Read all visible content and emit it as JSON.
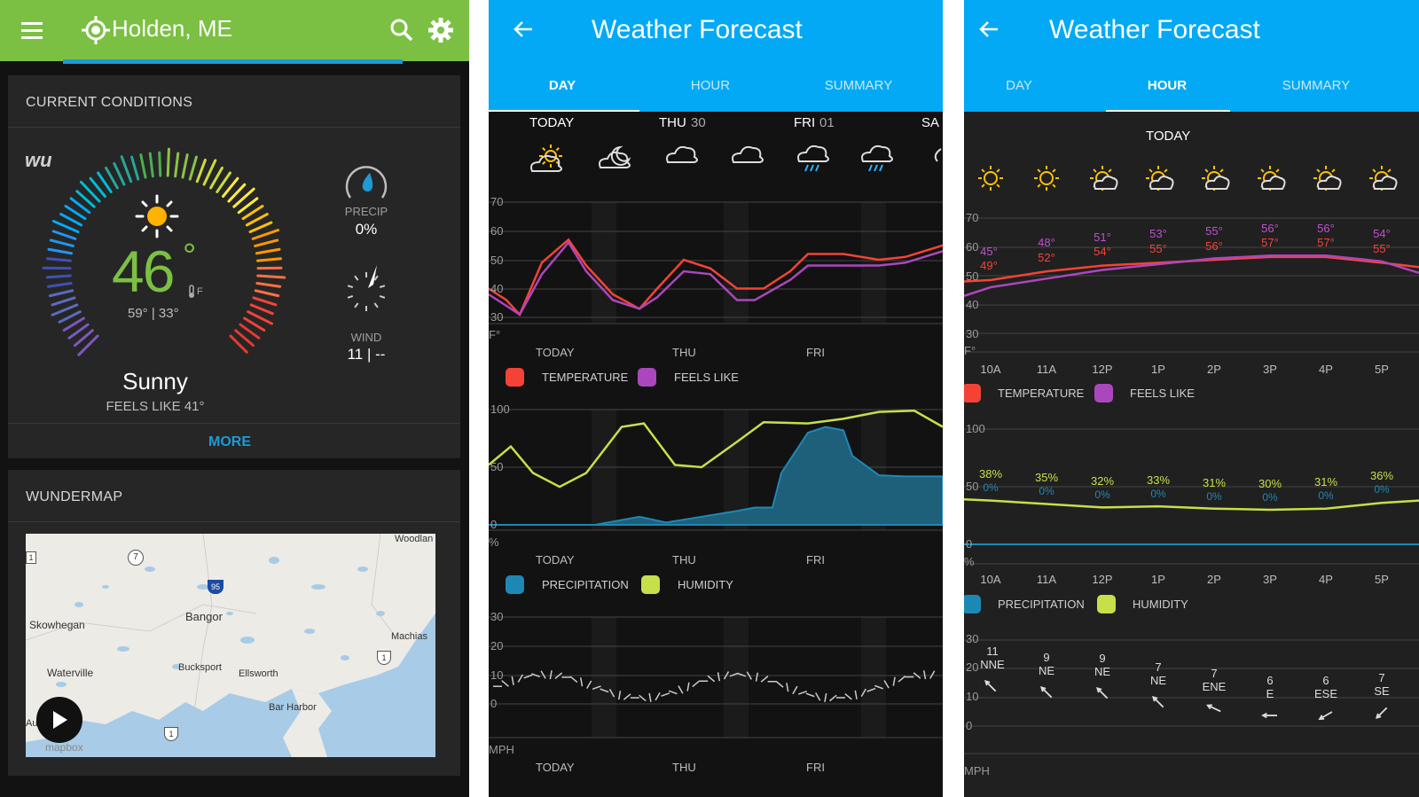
{
  "colors": {
    "green": "#7bc043",
    "blue": "#03a9f4",
    "temperature": "#f44336",
    "feels_like": "#ab47bc",
    "precipitation": "#1e88b5",
    "humidity": "#c6e04a",
    "link": "#1e9ad6"
  },
  "s1": {
    "location": "Holden, ME",
    "current": {
      "title": "CURRENT CONDITIONS",
      "temp": "46",
      "deg": "°",
      "unit": "F",
      "hilo": "59° | 33°",
      "condition": "Sunny",
      "feels_like": "FEELS LIKE 41°",
      "precip_label": "PRECIP",
      "precip_value": "0%",
      "wind_label": "WIND",
      "wind_value": "11 | --",
      "more": "MORE",
      "logo": "wu"
    },
    "map": {
      "title": "WUNDERMAP",
      "attribution": "mapbox",
      "places": {
        "woodland": "Woodlan",
        "skowhegan": "Skowhegan",
        "bangor": "Bangor",
        "machias": "Machias",
        "waterville": "Waterville",
        "bucksport": "Bucksport",
        "ellsworth": "Ellsworth",
        "bar_harbor": "Bar Harbor",
        "au": "Au"
      },
      "shields": {
        "s7": "7",
        "s95": "95",
        "s1a": "1",
        "s1b": "1",
        "s1c": "1"
      }
    }
  },
  "s2": {
    "title": "Weather Forecast",
    "tabs": [
      "DAY",
      "HOUR",
      "SUMMARY"
    ],
    "days": [
      "TODAY",
      "THU",
      "30",
      "FRI",
      "01",
      "SA"
    ],
    "x_labels": [
      "TODAY",
      "THU",
      "FRI"
    ],
    "temp_axis": [
      "70",
      "60",
      "50",
      "40",
      "30"
    ],
    "temp_unit": "F°",
    "legend1": [
      "TEMPERATURE",
      "FEELS LIKE"
    ],
    "hum_axis": [
      "100",
      "50",
      "0"
    ],
    "pct_unit": "%",
    "legend2": [
      "PRECIPITATION",
      "HUMIDITY"
    ],
    "wind_axis": [
      "30",
      "20",
      "10",
      "0"
    ],
    "wind_unit": "MPH"
  },
  "s3": {
    "title": "Weather Forecast",
    "tabs": [
      "DAY",
      "HOUR",
      "SUMMARY"
    ],
    "day": "TODAY",
    "hours": [
      "10A",
      "11A",
      "12P",
      "1P",
      "2P",
      "3P",
      "4P",
      "5P"
    ],
    "temp_axis": [
      "70",
      "60",
      "50",
      "40",
      "30"
    ],
    "temp_unit": "F°",
    "feels": [
      "45°",
      "48°",
      "51°",
      "53°",
      "55°",
      "56°",
      "56°",
      "54°"
    ],
    "temps": [
      "49°",
      "52°",
      "54°",
      "55°",
      "56°",
      "57°",
      "57°",
      "55°"
    ],
    "legend1": [
      "TEMPERATURE",
      "FEELS LIKE"
    ],
    "hum_axis": [
      "100",
      "50",
      "0"
    ],
    "pct_unit": "%",
    "humidity": [
      "38%",
      "35%",
      "32%",
      "33%",
      "31%",
      "30%",
      "31%",
      "36%"
    ],
    "precip": [
      "0%",
      "0%",
      "0%",
      "0%",
      "0%",
      "0%",
      "0%",
      "0%"
    ],
    "legend2": [
      "PRECIPITATION",
      "HUMIDITY"
    ],
    "wind_axis": [
      "30",
      "20",
      "10",
      "0"
    ],
    "wind_unit": "MPH",
    "wind_speed": [
      "11",
      "9",
      "9",
      "7",
      "7",
      "6",
      "6",
      "7"
    ],
    "wind_dir": [
      "NNE",
      "NE",
      "NE",
      "NE",
      "ENE",
      "E",
      "ESE",
      "SE"
    ]
  }
}
